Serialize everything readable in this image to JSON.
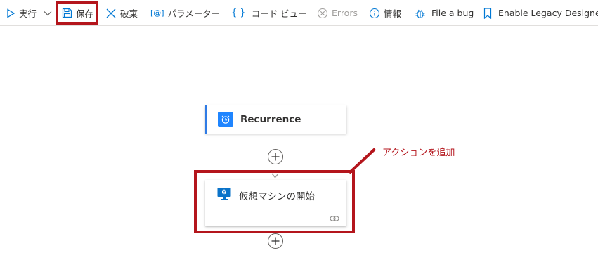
{
  "toolbar": {
    "run_label": "実行",
    "save_label": "保存",
    "discard_label": "破棄",
    "parameters_label": "パラメーター",
    "code_view_label": "コード ビュー",
    "errors_label": "Errors",
    "info_label": "情報",
    "file_bug_label": "File a bug",
    "legacy_designer_label": "Enable Legacy Designer"
  },
  "canvas": {
    "recurrence_title": "Recurrence",
    "vm_action_title": "仮想マシンの開始"
  },
  "annotation": {
    "text": "アクションを追加"
  },
  "colors": {
    "accent": "#0078d4",
    "highlight": "#b4151c",
    "recurrence_bar": "#2f7be5",
    "vm_icon": "#0a73c9"
  }
}
